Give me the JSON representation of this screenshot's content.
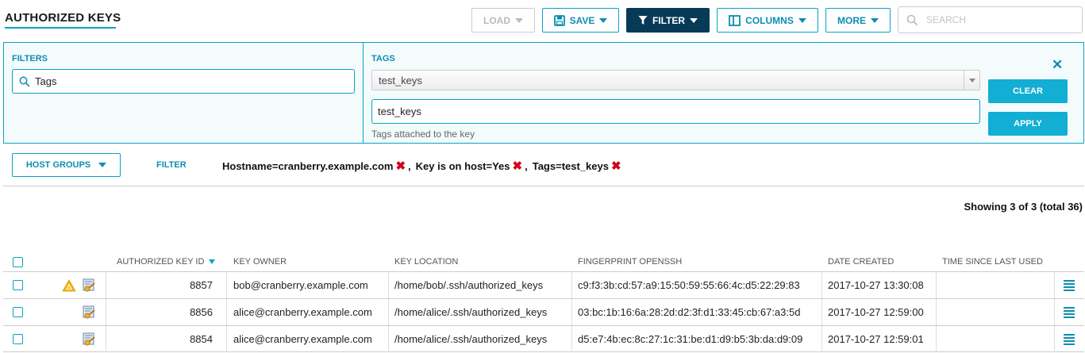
{
  "page": {
    "title": "AUTHORIZED KEYS"
  },
  "toolbar": {
    "load_label": "LOAD",
    "save_label": "SAVE",
    "filter_label": "FILTER",
    "columns_label": "COLUMNS",
    "more_label": "MORE",
    "search_placeholder": "SEARCH"
  },
  "filters_panel": {
    "filters_heading": "FILTERS",
    "filters_value": "Tags",
    "tags_heading": "TAGS",
    "tags_selected": "test_keys",
    "tags_value": "test_keys",
    "tags_help": "Tags attached to the key",
    "clear_label": "CLEAR",
    "apply_label": "APPLY",
    "close_glyph": "✕"
  },
  "filter_bar": {
    "host_groups_label": "HOST GROUPS",
    "filter_label": "FILTER",
    "chips": [
      "Hostname=cranberry.example.com",
      "Key is on host=Yes",
      "Tags=test_keys"
    ]
  },
  "showing": "Showing 3 of 3 (total 36)",
  "table": {
    "columns": [
      "AUTHORIZED KEY ID",
      "KEY OWNER",
      "KEY LOCATION",
      "FINGERPRINT OPENSSH",
      "DATE CREATED",
      "TIME SINCE LAST USED"
    ],
    "rows": [
      {
        "id": "8857",
        "owner": "bob@cranberry.example.com",
        "location": "/home/bob/.ssh/authorized_keys",
        "fingerprint": "c9:f3:3b:cd:57:a9:15:50:59:55:66:4c:d5:22:29:83",
        "created": "2017-10-27 13:30:08",
        "last_used": "",
        "icons": [
          "warning-icon",
          "key-certificate-icon"
        ]
      },
      {
        "id": "8856",
        "owner": "alice@cranberry.example.com",
        "location": "/home/alice/.ssh/authorized_keys",
        "fingerprint": "03:bc:1b:16:6a:28:2d:d2:3f:d1:33:45:cb:67:a3:5d",
        "created": "2017-10-27 12:59:00",
        "last_used": "",
        "icons": [
          "key-certificate-icon"
        ]
      },
      {
        "id": "8854",
        "owner": "alice@cranberry.example.com",
        "location": "/home/alice/.ssh/authorized_keys",
        "fingerprint": "d5:e7:4b:ec:8c:27:1c:31:be:d1:d9:b5:3b:da:d9:09",
        "created": "2017-10-27 12:59:01",
        "last_used": "",
        "icons": [
          "key-certificate-icon"
        ]
      }
    ]
  },
  "colors": {
    "accent": "#0aa3c2",
    "active_button": "#063a57",
    "primary_button": "#12aed3",
    "remove": "#d0021b",
    "warning": "#f5b400"
  }
}
